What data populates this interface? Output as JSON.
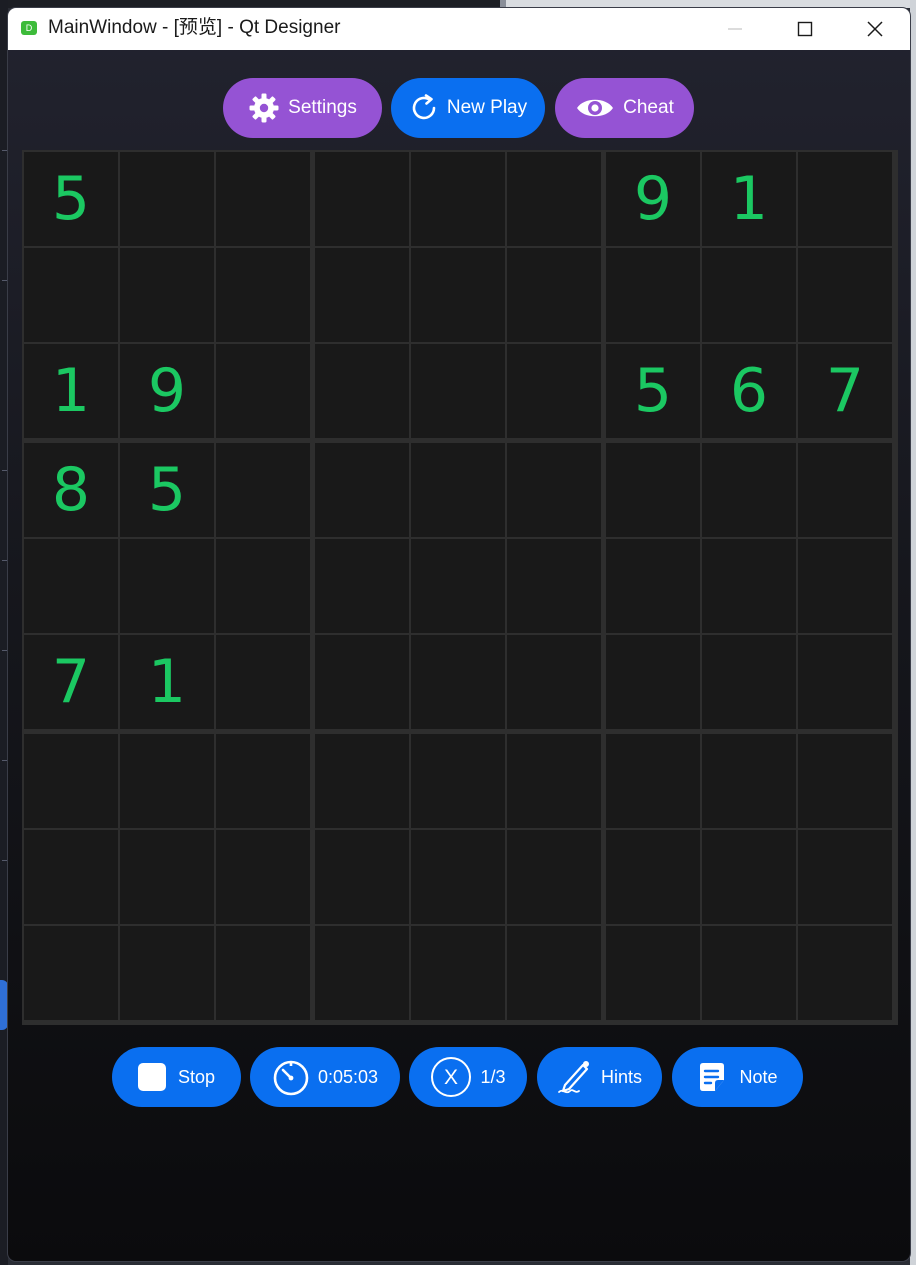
{
  "window": {
    "title": "MainWindow - [预览] - Qt Designer",
    "app_icon_letter": "D"
  },
  "toolbar": {
    "settings_label": "Settings",
    "new_play_label": "New Play",
    "cheat_label": "Cheat"
  },
  "board": {
    "cells": [
      [
        "5",
        "",
        "",
        "",
        "",
        "",
        "9",
        "1",
        ""
      ],
      [
        "",
        "",
        "",
        "",
        "",
        "",
        "",
        "",
        ""
      ],
      [
        "1",
        "9",
        "",
        "",
        "",
        "",
        "5",
        "6",
        "7"
      ],
      [
        "8",
        "5",
        "",
        "",
        "",
        "",
        "",
        "",
        ""
      ],
      [
        "",
        "",
        "",
        "",
        "",
        "",
        "",
        "",
        ""
      ],
      [
        "7",
        "1",
        "",
        "",
        "",
        "",
        "",
        "",
        ""
      ],
      [
        "",
        "",
        "",
        "",
        "",
        "",
        "",
        "",
        ""
      ],
      [
        "",
        "",
        "",
        "",
        "",
        "",
        "",
        "",
        ""
      ],
      [
        "",
        "",
        "",
        "",
        "",
        "",
        "",
        "",
        ""
      ]
    ],
    "digit_color": "#1bc862"
  },
  "statusbar": {
    "stop_label": "Stop",
    "timer_value": "0:05:03",
    "mistakes_value": "1/3",
    "mistakes_icon_letter": "X",
    "hints_label": "Hints",
    "note_label": "Note"
  },
  "colors": {
    "accent_blue": "#0a6ff0",
    "accent_purple": "#9553d4",
    "cell_bg": "#191919",
    "grid_line": "#2e2e2e"
  }
}
